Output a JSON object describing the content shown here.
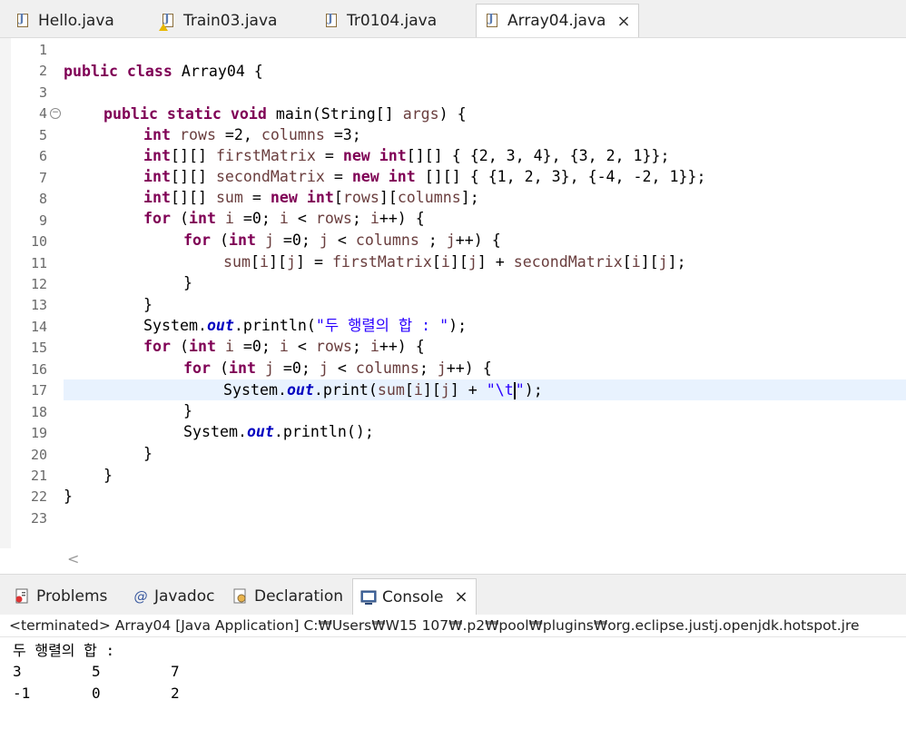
{
  "editor_tabs": [
    {
      "label": "Hello.java",
      "warning": false,
      "active": false
    },
    {
      "label": "Train03.java",
      "warning": true,
      "active": false
    },
    {
      "label": "Tr0104.java",
      "warning": false,
      "active": false
    },
    {
      "label": "Array04.java",
      "warning": false,
      "active": true
    }
  ],
  "close_symbol": "×",
  "code": {
    "line_numbers": [
      "1",
      "2",
      "3",
      "4",
      "5",
      "6",
      "7",
      "8",
      "9",
      "10",
      "11",
      "12",
      "13",
      "14",
      "15",
      "16",
      "17",
      "18",
      "19",
      "20",
      "21",
      "22",
      "23"
    ],
    "fold_marker_line": "4",
    "current_line": "17",
    "lines": {
      "l2_kw": "public class ",
      "l2_rest": "Array04 {",
      "l4_kw": "public static void ",
      "l4_a": "main(String[] ",
      "l4_var": "args",
      "l4_b": ") {",
      "l5_kw": "int ",
      "l5_v1": "rows",
      "l5_a": " =2, ",
      "l5_v2": "columns",
      "l5_b": " =3;",
      "l6_kw1": "int",
      "l6_a": "[][] ",
      "l6_var": "firstMatrix",
      "l6_b": " = ",
      "l6_kw2": "new ",
      "l6_kw3": "int",
      "l6_c": "[][] { {2, 3, 4}, {3, 2, 1}};",
      "l7_kw1": "int",
      "l7_a": "[][] ",
      "l7_var": "secondMatrix",
      "l7_b": " = ",
      "l7_kw2": "new ",
      "l7_kw3": "int",
      "l7_c": " [][] { {1, 2, 3}, {-4, -2, 1}};",
      "l8_kw1": "int",
      "l8_a": "[][] ",
      "l8_var": "sum",
      "l8_b": " = ",
      "l8_kw2": "new ",
      "l8_kw3": "int",
      "l8_c": "[",
      "l8_v1": "rows",
      "l8_d": "][",
      "l8_v2": "columns",
      "l8_e": "];",
      "l9_kw1": "for ",
      "l9_a": "(",
      "l9_kw2": "int ",
      "l9_v1": "i",
      "l9_b": " =0; ",
      "l9_v2": "i",
      "l9_c": " < ",
      "l9_v3": "rows",
      "l9_d": "; ",
      "l9_v4": "i",
      "l9_e": "++) {",
      "l10_kw1": "for ",
      "l10_a": "(",
      "l10_kw2": "int ",
      "l10_v1": "j",
      "l10_b": " =0; ",
      "l10_v2": "j",
      "l10_c": " < ",
      "l10_v3": "columns",
      "l10_d": " ; ",
      "l10_v4": "j",
      "l10_e": "++) {",
      "l11_v1": "sum",
      "l11_a": "[",
      "l11_v2": "i",
      "l11_b": "][",
      "l11_v3": "j",
      "l11_c": "] = ",
      "l11_v4": "firstMatrix",
      "l11_d": "[",
      "l11_v5": "i",
      "l11_e": "][",
      "l11_v6": "j",
      "l11_f": "] + ",
      "l11_v7": "secondMatrix",
      "l11_g": "[",
      "l11_v8": "i",
      "l11_h": "][",
      "l11_v9": "j",
      "l11_i": "];",
      "l12": "}",
      "l13": "}",
      "l14_a": "System.",
      "l14_fld": "out",
      "l14_b": ".println(",
      "l14_str": "\"두 행렬의 합 : \"",
      "l14_c": ");",
      "l15_kw1": "for ",
      "l15_a": "(",
      "l15_kw2": "int ",
      "l15_v1": "i",
      "l15_b": " =0; ",
      "l15_v2": "i",
      "l15_c": " < ",
      "l15_v3": "rows",
      "l15_d": "; ",
      "l15_v4": "i",
      "l15_e": "++) {",
      "l16_kw1": "for ",
      "l16_a": "(",
      "l16_kw2": "int ",
      "l16_v1": "j",
      "l16_b": " =0; ",
      "l16_v2": "j",
      "l16_c": " < ",
      "l16_v3": "columns",
      "l16_d": "; ",
      "l16_v4": "j",
      "l16_e": "++) {",
      "l17_a": "System.",
      "l17_fld": "out",
      "l17_b": ".print(",
      "l17_v1": "sum",
      "l17_c": "[",
      "l17_v2": "i",
      "l17_d": "][",
      "l17_v3": "j",
      "l17_e": "] + ",
      "l17_str1": "\"\\t",
      "l17_str2": "\"",
      "l17_f": ");",
      "l18": "}",
      "l19": "System.out.println();",
      "l19_a": "System.",
      "l19_fld": "out",
      "l19_b": ".println();",
      "l20": "}",
      "l21": "}",
      "l22": "}"
    }
  },
  "scroll_left_arrow": "<",
  "panel_tabs": [
    {
      "label": "Problems",
      "icon": "problems-icon",
      "active": false
    },
    {
      "label": "Javadoc",
      "icon": "javadoc-at-icon",
      "active": false
    },
    {
      "label": "Declaration",
      "icon": "declaration-icon",
      "active": false
    },
    {
      "label": "Console",
      "icon": "console-icon",
      "active": true
    }
  ],
  "javadoc_glyph": "@",
  "console": {
    "header": "<terminated> Array04 [Java Application] C:₩Users₩W15 107₩.p2₩pool₩plugins₩org.eclipse.justj.openjdk.hotspot.jre",
    "output_title": "두 행렬의 합 :",
    "rows": [
      [
        "3",
        "5",
        "7"
      ],
      [
        "-1",
        "0",
        "2"
      ]
    ]
  },
  "colors": {
    "keyword": "#7f0055",
    "variable": "#6a3e3e",
    "field": "#0000c0",
    "string": "#2a00ff",
    "current_line": "#e8f2fe"
  }
}
